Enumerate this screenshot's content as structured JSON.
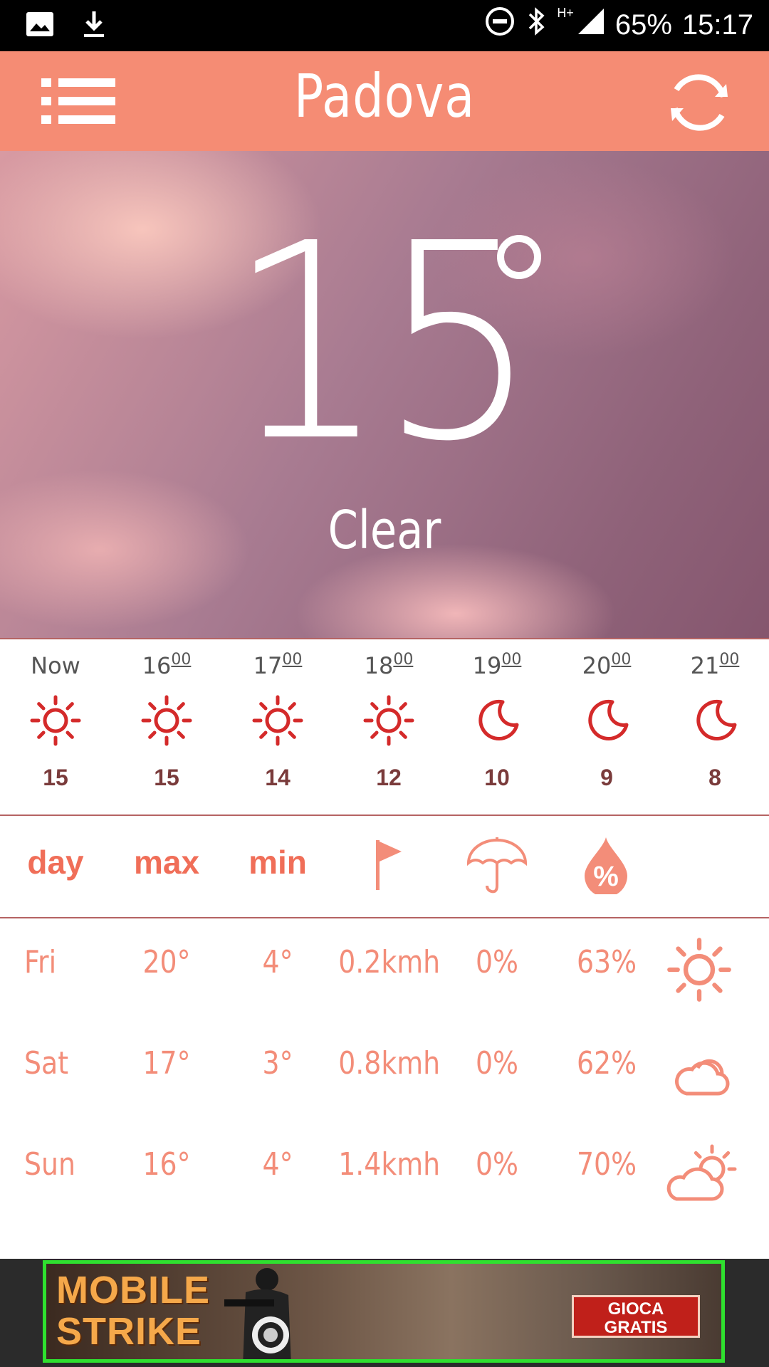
{
  "status_bar": {
    "battery": "65%",
    "time": "15:17",
    "network": "H+"
  },
  "app_bar": {
    "title": "Padova"
  },
  "current": {
    "temperature": "15",
    "condition": "Clear"
  },
  "hourly": [
    {
      "hour": "Now",
      "minutes": "",
      "temp": "15",
      "icon": "sun-icon"
    },
    {
      "hour": "16",
      "minutes": "00",
      "temp": "15",
      "icon": "sun-icon"
    },
    {
      "hour": "17",
      "minutes": "00",
      "temp": "14",
      "icon": "sun-icon"
    },
    {
      "hour": "18",
      "minutes": "00",
      "temp": "12",
      "icon": "sun-icon"
    },
    {
      "hour": "19",
      "minutes": "00",
      "temp": "10",
      "icon": "moon-icon"
    },
    {
      "hour": "20",
      "minutes": "00",
      "temp": "9",
      "icon": "moon-icon"
    },
    {
      "hour": "21",
      "minutes": "00",
      "temp": "8",
      "icon": "moon-icon"
    }
  ],
  "daily_header": {
    "day": "day",
    "max": "max",
    "min": "min",
    "wind_icon": "flag-icon",
    "rain_icon": "umbrella-icon",
    "humidity_icon": "humidity-drop-icon",
    "humidity_symbol": "%"
  },
  "daily": [
    {
      "day": "Fri",
      "max": "20°",
      "min": "4°",
      "wind": "0.2kmh",
      "rain": "0%",
      "humidity": "63%",
      "icon": "sun-icon"
    },
    {
      "day": "Sat",
      "max": "17°",
      "min": "3°",
      "wind": "0.8kmh",
      "rain": "0%",
      "humidity": "62%",
      "icon": "cloud-icon"
    },
    {
      "day": "Sun",
      "max": "16°",
      "min": "4°",
      "wind": "1.4kmh",
      "rain": "0%",
      "humidity": "70%",
      "icon": "partly-cloudy-icon"
    }
  ],
  "ad": {
    "brand_line1": "MOBILE",
    "brand_line2": "STRIKE",
    "cta_line1": "GIOCA",
    "cta_line2": "GRATIS"
  },
  "colors": {
    "app_bar": "#f58c74",
    "accent_dark": "#d42a2a",
    "accent_light": "#f38d79"
  }
}
